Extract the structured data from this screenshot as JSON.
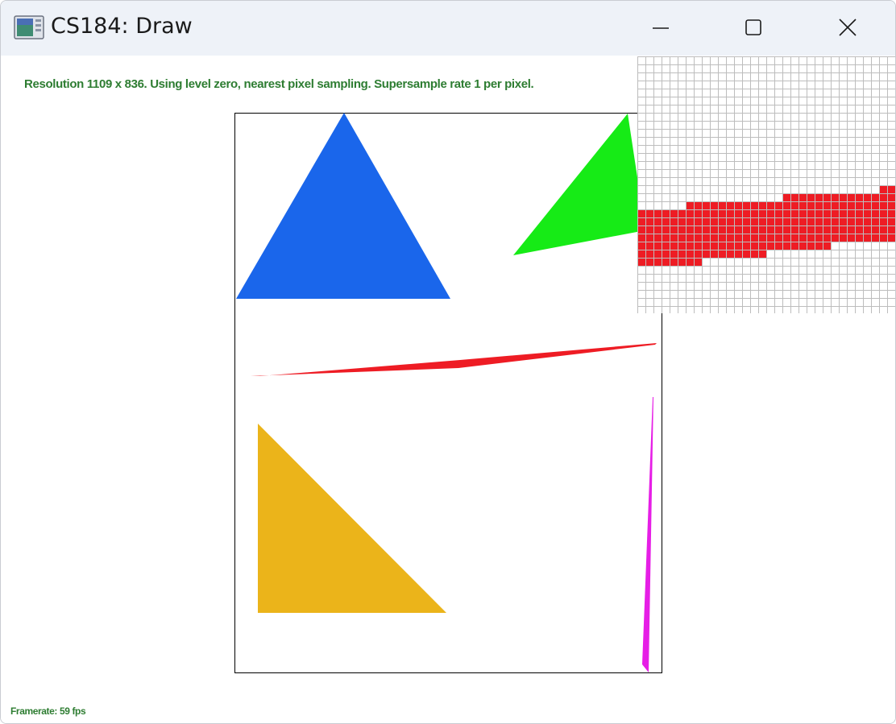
{
  "window": {
    "title": "CS184: Draw",
    "buttons": {
      "minimize": "minimize",
      "maximize": "maximize",
      "close": "close"
    }
  },
  "status": {
    "info": "Resolution 1109 x 836. Using level zero, nearest pixel sampling. Supersample rate 1 per pixel.",
    "framerate": "Framerate: 59 fps"
  },
  "colors": {
    "titlebar": "#eef2f8",
    "status_text": "#2e7d32",
    "blue_triangle": "#1a66eb",
    "green_triangle": "#16eb16",
    "red_sliver": "#ee1c24",
    "yellow_triangle": "#ebb41a",
    "magenta_sliver": "#e61ee6",
    "zoom_grid": "#bdbdbd"
  },
  "icons": {
    "app": "app-window-icon",
    "minimize": "minimize-icon",
    "maximize": "maximize-icon",
    "close": "close-icon"
  }
}
